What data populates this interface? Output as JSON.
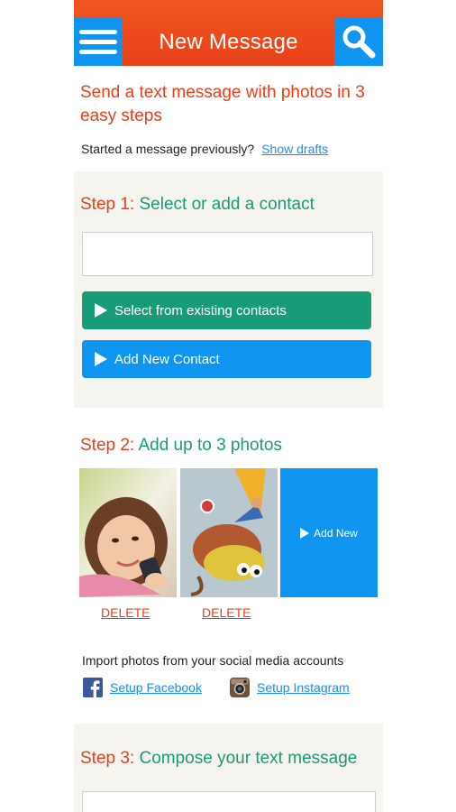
{
  "header": {
    "title": "New Message",
    "menu_icon": "hamburger-menu-icon",
    "search_icon": "search-icon"
  },
  "intro": {
    "headline": "Send a text message with photos in 3 easy steps",
    "drafts_prompt": "Started a message previously?",
    "drafts_link": "Show drafts"
  },
  "step1": {
    "number": "Step 1:",
    "title": "Select or add a contact",
    "contact_input_value": "",
    "select_button": "Select from existing contacts",
    "add_button": "Add New Contact"
  },
  "step2": {
    "number": "Step 2:",
    "title": "Add up to 3 photos",
    "photos": [
      {
        "description": "girl-selfie-photo",
        "delete_label": "DELETE"
      },
      {
        "description": "cartoon-fish-rider-photo",
        "delete_label": "DELETE"
      }
    ],
    "add_new_label": "Add New",
    "import_text": "Import photos from your social media accounts",
    "facebook_link": "Setup Facebook",
    "instagram_link": "Setup Instagram"
  },
  "step3": {
    "number": "Step 3:",
    "title": "Compose your text message",
    "message_value": ""
  },
  "colors": {
    "header_orange": "#e8401a",
    "accent_blue": "#0f94f0",
    "accent_green": "#189c78",
    "step_text_green": "#1b9a7a",
    "panel_bg": "#f5f4ee"
  }
}
